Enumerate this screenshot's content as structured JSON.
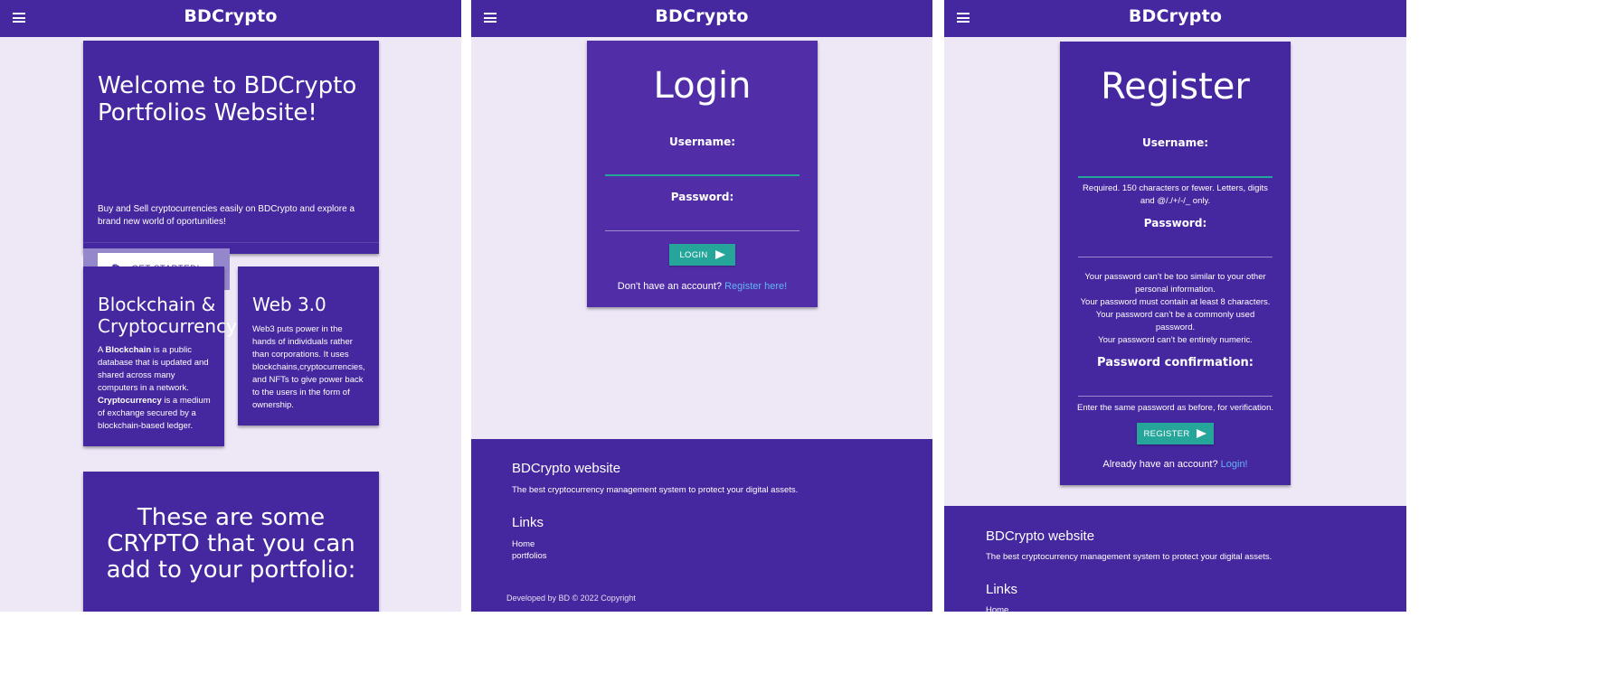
{
  "brand": "BDCrypto",
  "home": {
    "hero": {
      "title": "Welcome to BDCrypto Portfolios Website!",
      "description": "Buy and Sell cryptocurrencies easily on BDCrypto and explore a brand new world of oportunities!",
      "cta_label": "GET STARTED!",
      "cta_icon": "bitcoin-icon"
    },
    "blockchain_card": {
      "title_line1": "Blockchain &",
      "title_line2": "Cryptocurrency",
      "blockchain_term": "Blockchain",
      "blockchain_text": "is a public database that is updated and shared across many computers in a network.",
      "crypto_term": "Cryptocurrency",
      "crypto_text": "is a medium of exchange secured by a blockchain-based ledger.",
      "article_a": "A"
    },
    "web3_card": {
      "title": "Web 3.0",
      "body": "Web3 puts power in the hands of individuals rather than corporations. It uses blockchains,cryptocurrencies, and NFTs to give power back to the users in the form of ownership."
    },
    "crypto_card": {
      "title": "These are some CRYPTO that you can add to your portfolio:"
    }
  },
  "login": {
    "title": "Login",
    "username_label": "Username:",
    "password_label": "Password:",
    "button_label": "LOGIN",
    "prompt": "Don't have an account?",
    "link": "Register here!"
  },
  "register": {
    "title": "Register",
    "username_label": "Username:",
    "username_help_1": "Required. 150 characters or fewer. Letters, digits",
    "username_help_2": "and @/./+/-/_ only.",
    "password_label": "Password:",
    "password_help": [
      "Your password can’t be too similar to your other",
      "personal information.",
      "Your password must contain at least 8 characters.",
      "Your password can’t be a commonly used",
      "password.",
      "Your password can’t be entirely numeric."
    ],
    "confirm_label": "Password confirmation:",
    "confirm_help": "Enter the same password as before, for verification.",
    "button_label": "REGISTER",
    "prompt": "Already have an account?",
    "link": "Login!"
  },
  "footer": {
    "title": "BDCrypto website",
    "description": "The best cryptocurrency management system to protect your digital assets.",
    "links_title": "Links",
    "links": [
      "Home",
      "portfolios"
    ],
    "copyright": "Developed by BD © 2022 Copyright"
  },
  "colors": {
    "primary": "#4527a0",
    "background": "#ede7f6",
    "accent": "#26a69a",
    "link": "#64b5f6"
  }
}
